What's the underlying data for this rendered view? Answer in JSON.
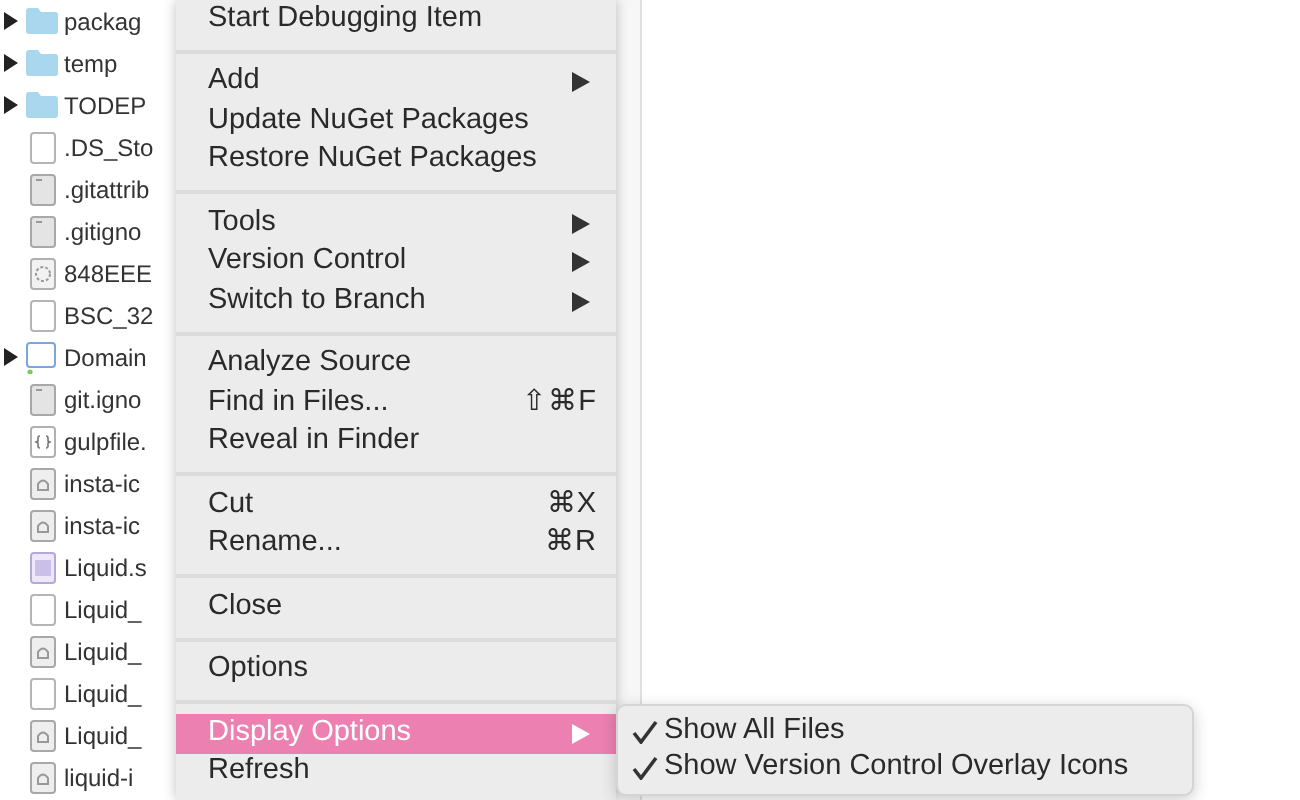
{
  "file_tree": [
    {
      "name": "packag",
      "kind": "folder",
      "expandable": true
    },
    {
      "name": "temp",
      "kind": "folder",
      "expandable": true
    },
    {
      "name": "TODEP",
      "kind": "folder",
      "expandable": true
    },
    {
      "name": ".DS_Sto",
      "kind": "blank",
      "expandable": false
    },
    {
      "name": ".gitattrib",
      "kind": "text",
      "expandable": false
    },
    {
      "name": ".gitigno",
      "kind": "text",
      "expandable": false
    },
    {
      "name": "848EEE",
      "kind": "gear",
      "expandable": false
    },
    {
      "name": "BSC_32",
      "kind": "blank",
      "expandable": false
    },
    {
      "name": "Domain",
      "kind": "project",
      "expandable": true
    },
    {
      "name": "git.igno",
      "kind": "text",
      "expandable": false
    },
    {
      "name": "gulpfile.",
      "kind": "code",
      "expandable": false
    },
    {
      "name": "insta-ic",
      "kind": "image",
      "expandable": false
    },
    {
      "name": "insta-ic",
      "kind": "image",
      "expandable": false
    },
    {
      "name": "Liquid.s",
      "kind": "window",
      "expandable": false
    },
    {
      "name": "Liquid_",
      "kind": "blank",
      "expandable": false
    },
    {
      "name": "Liquid_",
      "kind": "image",
      "expandable": false
    },
    {
      "name": "Liquid_",
      "kind": "blank",
      "expandable": false
    },
    {
      "name": "Liquid_",
      "kind": "image",
      "expandable": false
    },
    {
      "name": "liquid-i",
      "kind": "image",
      "expandable": false
    }
  ],
  "context_menu": [
    [
      {
        "label": "Start Debugging Item",
        "submenu": false,
        "selected": false
      }
    ],
    [
      {
        "label": "Add",
        "submenu": true,
        "selected": false
      },
      {
        "label": "Update NuGet Packages",
        "submenu": false,
        "selected": false
      },
      {
        "label": "Restore NuGet Packages",
        "submenu": false,
        "selected": false
      }
    ],
    [
      {
        "label": "Tools",
        "submenu": true,
        "selected": false
      },
      {
        "label": "Version Control",
        "submenu": true,
        "selected": false
      },
      {
        "label": "Switch to Branch",
        "submenu": true,
        "selected": false
      }
    ],
    [
      {
        "label": "Analyze Source",
        "submenu": false,
        "selected": false
      },
      {
        "label": "Find in Files...",
        "shortcut": "⇧⌘F",
        "submenu": false,
        "selected": false
      },
      {
        "label": "Reveal in Finder",
        "submenu": false,
        "selected": false
      }
    ],
    [
      {
        "label": "Cut",
        "shortcut": "⌘X",
        "submenu": false,
        "selected": false
      },
      {
        "label": "Rename...",
        "shortcut": "⌘R",
        "submenu": false,
        "selected": false
      }
    ],
    [
      {
        "label": "Close",
        "submenu": false,
        "selected": false
      }
    ],
    [
      {
        "label": "Options",
        "submenu": false,
        "selected": false
      }
    ],
    [
      {
        "label": "Display Options",
        "submenu": true,
        "selected": true
      },
      {
        "label": "Refresh",
        "submenu": false,
        "selected": false
      }
    ]
  ],
  "submenu": [
    {
      "label": "Show All Files",
      "checked": true
    },
    {
      "label": "Show Version Control Overlay Icons",
      "checked": true
    }
  ]
}
